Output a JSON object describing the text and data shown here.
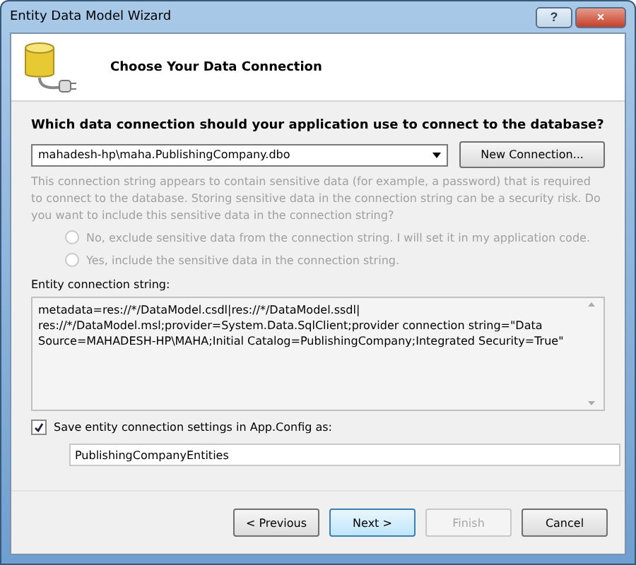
{
  "window": {
    "title": "Entity Data Model Wizard",
    "controls": [
      "?",
      "×"
    ]
  },
  "header": {
    "title": "Choose Your Data Connection"
  },
  "question": "Which data connection should your application use to connect to the database?",
  "connection": {
    "value": "mahadesh-hp\\maha.PublishingCompany.dbo"
  },
  "new_connection_button": "New Connection...",
  "sensitive": {
    "text": "This connection string appears to contain sensitive data (for example, a password) that is required to connect to the database. Storing sensitive data in the connection string can be a security risk. Do you want to include this sensitive data in the connection string?",
    "disabled": true,
    "options": [
      {
        "label": "No, exclude sensitive data from the connection string. I will set it in my application code.",
        "selected": false
      },
      {
        "label": "Yes, include the sensitive data in the connection string.",
        "selected": false
      }
    ]
  },
  "entity_label": "Entity connection string:",
  "entity_string": "metadata=res://*/DataModel.csdl|res://*/DataModel.ssdl|\nres://*/DataModel.msl;provider=System.Data.SqlClient;provider connection string=\"Data Source=MAHADESH-HP\\MAHA;Initial Catalog=PublishingCompany;Integrated Security=True\"",
  "save": {
    "label": "Save entity connection settings in App.Config as:",
    "checked": true,
    "value": "PublishingCompanyEntities"
  },
  "buttons": [
    {
      "label": "< Previous",
      "disabled": false,
      "default": false
    },
    {
      "label": "Next >",
      "disabled": false,
      "default": true
    },
    {
      "label": "Finish",
      "disabled": true,
      "default": false
    },
    {
      "label": "Cancel",
      "disabled": false,
      "default": false
    }
  ]
}
